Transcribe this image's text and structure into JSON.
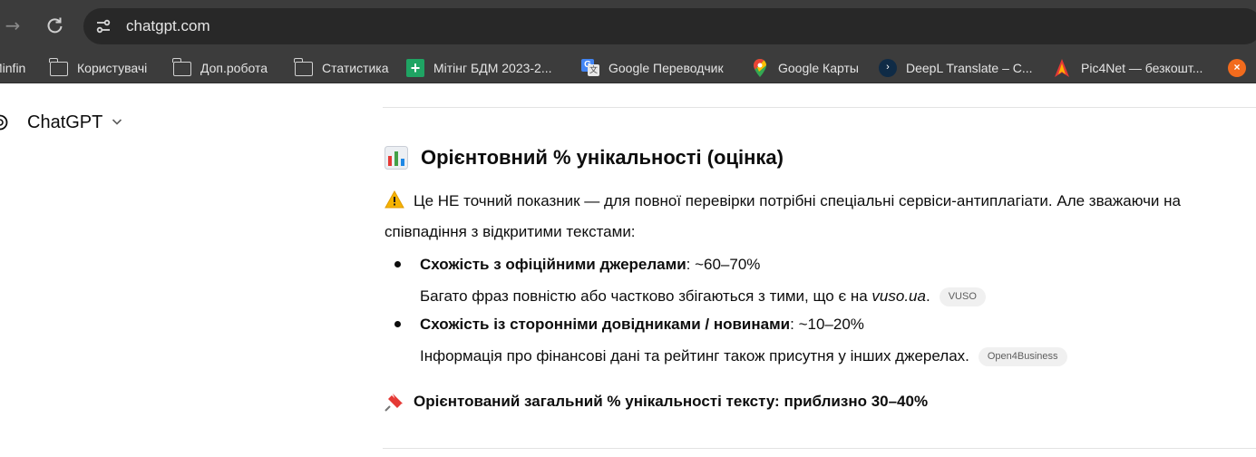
{
  "browser": {
    "url": "chatgpt.com",
    "bookmarks": [
      {
        "label": "Minfin",
        "icon": "none"
      },
      {
        "label": "Користувачі",
        "icon": "folder-icon"
      },
      {
        "label": "Доп.робота",
        "icon": "folder-icon"
      },
      {
        "label": "Статистика",
        "icon": "folder-icon"
      },
      {
        "label": "Мітінг БДМ 2023-2...",
        "icon": "google-sheets-icon"
      },
      {
        "label": "Google Переводчик",
        "icon": "google-translate-icon"
      },
      {
        "label": "Google Карты",
        "icon": "google-maps-icon"
      },
      {
        "label": "DeepL Translate – С...",
        "icon": "deepl-icon"
      },
      {
        "label": "Pic4Net — безкошт...",
        "icon": "pic4net-icon"
      },
      {
        "label": "",
        "icon": "orange-close-icon"
      }
    ]
  },
  "app": {
    "name": "ChatGPT"
  },
  "message": {
    "heading": "Орієнтовний % унікальності (оцінка)",
    "intro": "Це НЕ точний показник — для повної перевірки потрібні спеціальні сервіси-антиплагіати. Але зважаючи на співпадіння з відкритими текстами:",
    "items": [
      {
        "title": "Схожість з офіційними джерелами",
        "value": ": ~60–70%",
        "detail_prefix": "Багато фраз повністю або частково збігаються з тими, що є на ",
        "detail_em": "vuso.ua",
        "detail_suffix": ".",
        "source": "VUSO"
      },
      {
        "title": "Схожість із сторонніми довідниками / новинами",
        "value": ": ~10–20%",
        "detail_prefix": "Інформація про фінансові дані та рейтинг також присутня у інших джерелах.",
        "detail_em": "",
        "detail_suffix": "",
        "source": "Open4Business"
      }
    ],
    "summary": "Орієнтований загальний % унікальності тексту: приблизно 30–40%"
  }
}
